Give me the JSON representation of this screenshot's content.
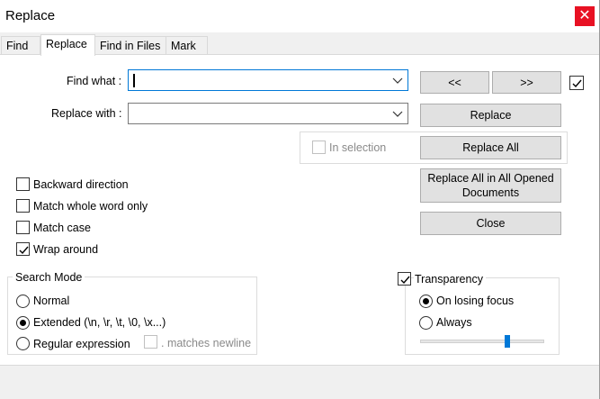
{
  "window": {
    "title": "Replace",
    "close_glyph": "✕"
  },
  "tabs": [
    {
      "label": "Find",
      "active": false
    },
    {
      "label": "Replace",
      "active": true
    },
    {
      "label": "Find in Files",
      "active": false
    },
    {
      "label": "Mark",
      "active": false
    }
  ],
  "find_what": {
    "label": "Find what :",
    "value": ""
  },
  "replace_with": {
    "label": "Replace with :",
    "value": ""
  },
  "buttons": {
    "prev": "<<",
    "next": ">>",
    "replace": "Replace",
    "replace_all": "Replace All",
    "replace_all_opened": "Replace All in All Opened Documents",
    "close": "Close"
  },
  "in_selection": {
    "label": "In selection",
    "checked": false,
    "enabled": false
  },
  "options": [
    {
      "label": "Backward direction",
      "checked": false
    },
    {
      "label": "Match whole word only",
      "checked": false
    },
    {
      "label": "Match case",
      "checked": false
    },
    {
      "label": "Wrap around",
      "checked": true
    }
  ],
  "search_mode": {
    "title": "Search Mode",
    "modes": [
      {
        "label": "Normal",
        "selected": false
      },
      {
        "label": "Extended (\\n, \\r, \\t, \\0, \\x...)",
        "selected": true
      },
      {
        "label": "Regular expression",
        "selected": false
      }
    ],
    "matches_newline": {
      "label": ". matches newline",
      "checked": false,
      "enabled": false
    }
  },
  "transparency": {
    "label": "Transparency",
    "checked": true,
    "modes": [
      {
        "label": "On losing focus",
        "selected": true
      },
      {
        "label": "Always",
        "selected": false
      }
    ],
    "slider_level": 0.71
  },
  "follow_checkbox_checked": true,
  "colors": {
    "accent": "#0078d7",
    "close_red": "#e81123",
    "button_bg": "#e1e1e1"
  }
}
